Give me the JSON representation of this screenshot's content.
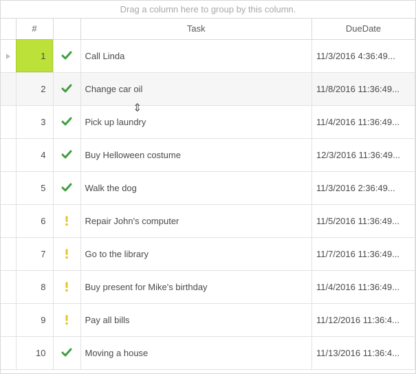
{
  "groupPanel": {
    "hint": "Drag a column here to group by this column."
  },
  "columns": {
    "number": "#",
    "status": "",
    "task": "Task",
    "due": "DueDate"
  },
  "rows": [
    {
      "n": "1",
      "status": "done",
      "task": "Call Linda",
      "due": "11/3/2016 4:36:49...",
      "selected": true,
      "hover": false
    },
    {
      "n": "2",
      "status": "done",
      "task": "Change car oil",
      "due": "11/8/2016 11:36:49...",
      "selected": false,
      "hover": true
    },
    {
      "n": "3",
      "status": "done",
      "task": "Pick up laundry",
      "due": "11/4/2016 11:36:49...",
      "selected": false,
      "hover": false
    },
    {
      "n": "4",
      "status": "done",
      "task": "Buy Helloween costume",
      "due": "12/3/2016 11:36:49...",
      "selected": false,
      "hover": false
    },
    {
      "n": "5",
      "status": "done",
      "task": "Walk the dog",
      "due": "11/3/2016 2:36:49...",
      "selected": false,
      "hover": false
    },
    {
      "n": "6",
      "status": "warn",
      "task": "Repair John's computer",
      "due": "11/5/2016 11:36:49...",
      "selected": false,
      "hover": false
    },
    {
      "n": "7",
      "status": "warn",
      "task": "Go to the library",
      "due": "11/7/2016 11:36:49...",
      "selected": false,
      "hover": false
    },
    {
      "n": "8",
      "status": "warn",
      "task": "Buy present for Mike's birthday",
      "due": "11/4/2016 11:36:49...",
      "selected": false,
      "hover": false
    },
    {
      "n": "9",
      "status": "warn",
      "task": "Pay all bills",
      "due": "11/12/2016 11:36:4...",
      "selected": false,
      "hover": false
    },
    {
      "n": "10",
      "status": "done",
      "task": "Moving a house",
      "due": "11/13/2016 11:36:4...",
      "selected": false,
      "hover": false
    }
  ],
  "icons": {
    "done_color": "#3f9e3f",
    "warn_color": "#e6c52a"
  }
}
